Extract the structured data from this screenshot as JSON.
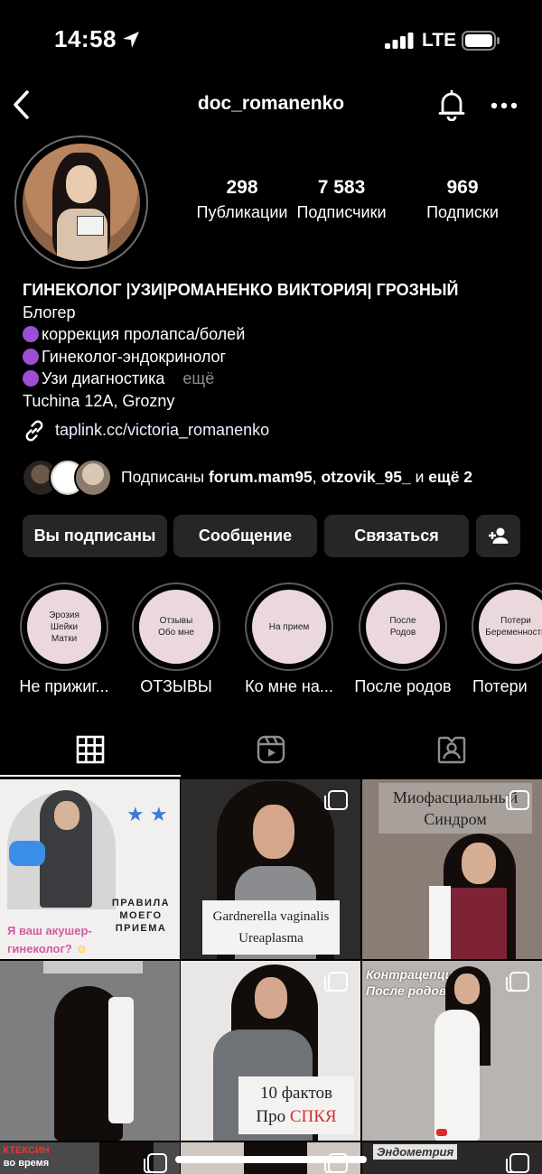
{
  "status_bar": {
    "time": "14:58",
    "network": "LTE"
  },
  "header": {
    "username": "doc_romanenko",
    "icons": [
      "back-icon",
      "bell-icon",
      "more-icon"
    ]
  },
  "stats": [
    {
      "num": "298",
      "label": "Публикации"
    },
    {
      "num": "7 583",
      "label": "Подписчики"
    },
    {
      "num": "969",
      "label": "Подписки"
    }
  ],
  "bio": {
    "name": "ГИНЕКОЛОГ |УЗИ|РОМАНЕНКО ВИКТОРИЯ| ГРОЗНЫЙ",
    "category": "Блогер",
    "lines": [
      "коррекция пролапса/болей",
      "Гинеколог-эндокринолог",
      "Узи диагностика"
    ],
    "more": "ещё",
    "location": "Tuchina 12A, Grozny",
    "link": "taplink.cc/victoria_romanenko"
  },
  "followed_by": {
    "prefix": "Подписаны ",
    "user1": "forum.mam95",
    "sep": ", ",
    "user2": "otzovik_95_",
    "suffix": " и ",
    "more": "ещё 2"
  },
  "buttons": {
    "following": "Вы подписаны",
    "message": "Сообщение",
    "contact": "Связаться"
  },
  "highlights": [
    {
      "cover": "Эрозия\nШейки\nМатки",
      "label": "Не прижиг..."
    },
    {
      "cover": "Отзывы\nОбо мне",
      "label": "ОТЗЫВЫ"
    },
    {
      "cover": "На прием",
      "label": "Ко мне на..."
    },
    {
      "cover": "После\nРодов",
      "label": "После родов"
    },
    {
      "cover": "Потери\nБеременности",
      "label": "Потери"
    }
  ],
  "tabs": [
    "grid-icon",
    "reels-icon",
    "tagged-icon"
  ],
  "posts": [
    {
      "text1": "ПРАВИЛА",
      "text2": "МОЕГО ПРИЕМА",
      "text3": "Я ваш акушер-",
      "text4": "гинеколог?"
    },
    {
      "text1": "Gardnerella vaginalis",
      "text2": "Ureaplasma"
    },
    {
      "text1": "Миофасциальный",
      "text2": "Синдром"
    },
    {
      "text1": ""
    },
    {
      "text1": "10 фактов",
      "text2": "Про ",
      "text3": "СПКЯ"
    },
    {
      "text1": "Контрацепция",
      "text2": "После родов"
    },
    {
      "text1": "КТЕКСИН",
      "text2": "во время"
    },
    {
      "text1": ""
    },
    {
      "text1": "Эндометрия"
    }
  ],
  "colors": {
    "background": "#000000",
    "button": "#262626",
    "accent_purple": "#9b4fd6",
    "highlight_fill": "#ead8dc",
    "spkya_red": "#d32f2f"
  }
}
